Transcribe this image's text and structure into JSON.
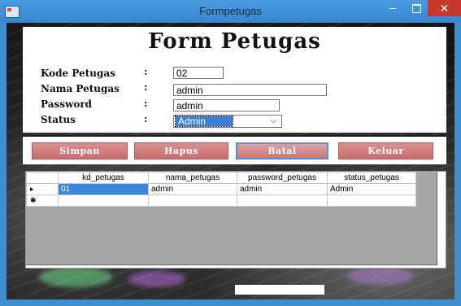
{
  "window": {
    "title": "Formpetugas",
    "icons": {
      "app": "form-icon",
      "minimize": "minimize-icon",
      "maximize": "maximize-icon",
      "close": "close-icon"
    },
    "min_glyph": "–",
    "close_glyph": "✕"
  },
  "header": {
    "title": "Form Petugas"
  },
  "form": {
    "kode": {
      "label": "Kode Petugas",
      "colon": ":",
      "value": "02"
    },
    "nama": {
      "label": "Nama Petugas",
      "colon": ":",
      "value": "admin"
    },
    "password": {
      "label": "Password",
      "colon": ":",
      "value": "admin"
    },
    "status": {
      "label": "Status",
      "colon": ":",
      "value": "Admin",
      "chevron": "⌵"
    }
  },
  "buttons": {
    "simpan": "Simpan",
    "hapus": "Hapus",
    "batal": "Batal",
    "keluar": "Keluar"
  },
  "grid": {
    "columns": [
      "kd_petugas",
      "nama_petugas",
      "password_petugas",
      "status_petugas"
    ],
    "rows": [
      {
        "indicator": "▸",
        "cells": [
          "01",
          "admin",
          "admin",
          "Admin"
        ]
      },
      {
        "indicator": "✱",
        "cells": [
          "",
          "",
          "",
          ""
        ]
      }
    ]
  },
  "colors": {
    "titlebar": "#3f8ecf",
    "close": "#c7372c",
    "button": "#c86e6e",
    "selection": "#3b87df"
  }
}
